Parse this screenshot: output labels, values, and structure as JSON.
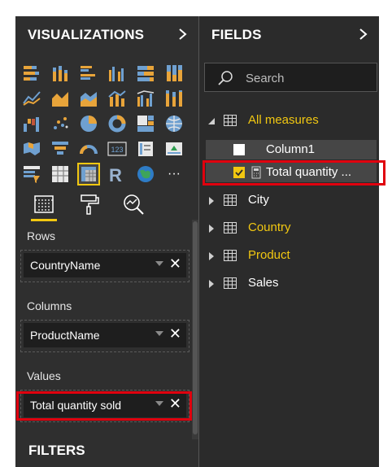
{
  "visualizations": {
    "title": "VISUALIZATIONS",
    "icons": [
      "stacked-bar-chart-icon",
      "stacked-column-chart-icon",
      "clustered-bar-chart-icon",
      "clustered-column-chart-icon",
      "100-stacked-bar-chart-icon",
      "100-stacked-column-chart-icon",
      "line-chart-icon",
      "area-chart-icon",
      "stacked-area-chart-icon",
      "line-and-stacked-column-chart-icon",
      "line-and-clustered-column-chart-icon",
      "ribbon-chart-icon",
      "waterfall-chart-icon",
      "scatter-chart-icon",
      "pie-chart-icon",
      "donut-chart-icon",
      "treemap-icon",
      "map-icon",
      "filled-map-icon",
      "funnel-icon",
      "gauge-icon",
      "card-icon",
      "multi-row-card-icon",
      "kpi-icon",
      "slicer-icon",
      "table-icon",
      "matrix-icon",
      "r-script-visual-icon",
      "arcgis-map-icon",
      "more-visuals-icon"
    ],
    "selected_icon": "matrix-icon",
    "card_text": "123",
    "r_text": "R",
    "more_text": "···",
    "tabs": [
      "fields-tab",
      "format-tab",
      "analytics-tab"
    ],
    "wells": [
      {
        "label": "Rows",
        "value": "CountryName"
      },
      {
        "label": "Columns",
        "value": "ProductName"
      },
      {
        "label": "Values",
        "value": "Total quantity sold"
      }
    ],
    "remove_glyph": "✕",
    "filters_title": "FILTERS"
  },
  "fields": {
    "title": "FIELDS",
    "search_placeholder": "Search",
    "tables": [
      {
        "name": "All measures",
        "expanded": true
      },
      {
        "name": "City",
        "expanded": false
      },
      {
        "name": "Country",
        "expanded": false
      },
      {
        "name": "Product",
        "expanded": false
      },
      {
        "name": "Sales",
        "expanded": false
      }
    ],
    "measures": [
      {
        "name": "Column1",
        "checked": false
      },
      {
        "name": "Total quantity ...",
        "checked": true
      }
    ]
  },
  "colors": {
    "accent": "#f2c811",
    "highlight": "#e0000e"
  }
}
